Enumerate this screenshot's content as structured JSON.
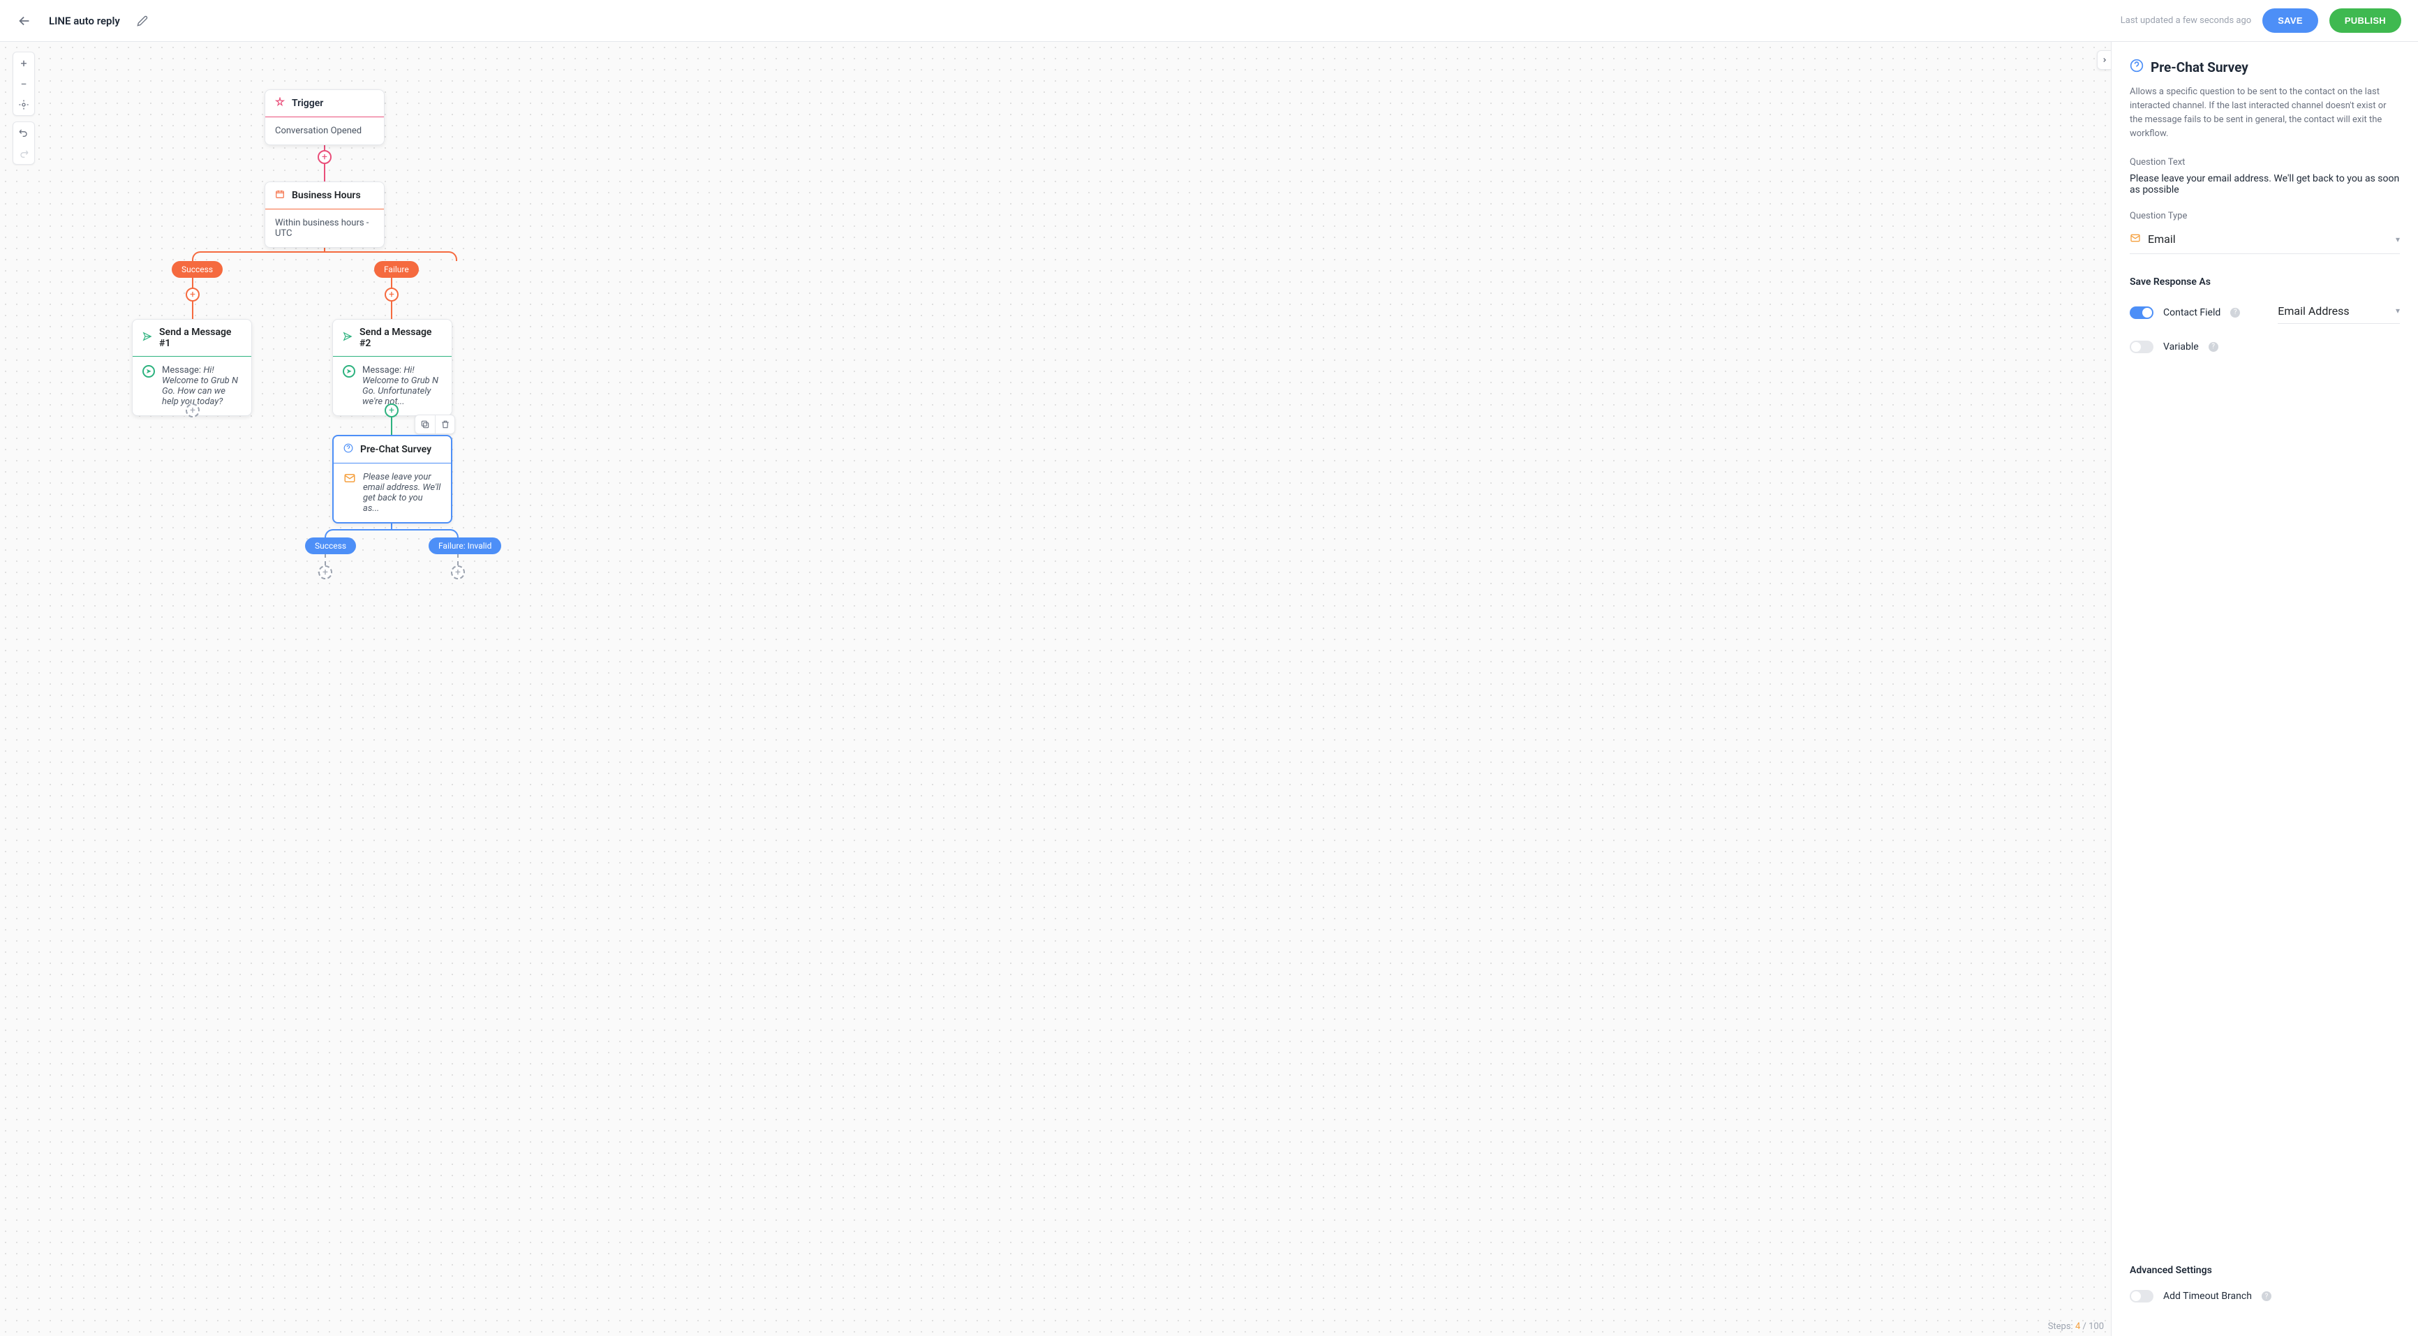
{
  "header": {
    "title": "LINE auto reply",
    "last_updated": "Last updated a few seconds ago",
    "save": "SAVE",
    "publish": "PUBLISH"
  },
  "canvas": {
    "trigger": {
      "title": "Trigger",
      "body": "Conversation Opened"
    },
    "bizhrs": {
      "title": "Business Hours",
      "body": "Within business hours - UTC"
    },
    "pills": {
      "success": "Success",
      "failure": "Failure",
      "success2": "Success",
      "failure_invalid": "Failure: Invalid"
    },
    "msg1": {
      "title": "Send a Message #1",
      "label": "Message: ",
      "text": "Hi! Welcome to Grub N Go. How can we help you today?"
    },
    "msg2": {
      "title": "Send a Message #2",
      "label": "Message: ",
      "text": "Hi! Welcome to Grub N Go. Unfortunately we're not..."
    },
    "survey": {
      "title": "Pre-Chat Survey",
      "text": "Please leave your email address. We'll get back to you as..."
    },
    "steps": {
      "label": "Steps: ",
      "current": "4",
      "sep": " / ",
      "total": "100"
    }
  },
  "sidebar": {
    "title": "Pre-Chat Survey",
    "description": "Allows a specific question to be sent to the contact on the last interacted channel. If the last interacted channel doesn't exist or the message fails to be sent in general, the contact will exit the workflow.",
    "question_text_label": "Question Text",
    "question_text_value": "Please leave your email address. We'll get back to you as soon as possible",
    "question_type_label": "Question Type",
    "question_type_value": "Email",
    "save_response_label": "Save Response As",
    "contact_field_label": "Contact Field",
    "email_address_value": "Email Address",
    "variable_label": "Variable",
    "advanced_label": "Advanced Settings",
    "timeout_label": "Add Timeout Branch"
  }
}
